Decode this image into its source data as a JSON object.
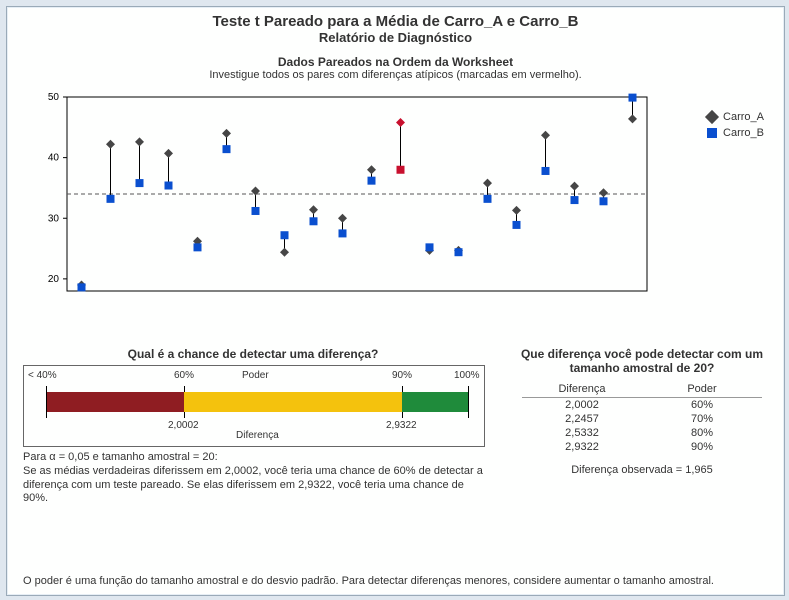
{
  "report": {
    "title": "Teste t Pareado para a Média de Carro_A e Carro_B",
    "subtitle": "Relatório de Diagnóstico"
  },
  "pair_plot": {
    "title": "Dados Pareados na Ordem da Worksheet",
    "subtitle": "Investigue todos os pares com diferenças atípicos (marcadas em vermelho).",
    "legend": {
      "seriesA": "Carro_A",
      "seriesB": "Carro_B"
    }
  },
  "power_plot": {
    "title": "Qual é a chance de detectar uma diferença?",
    "axis_power": "Poder",
    "axis_diff": "Diferença",
    "ticks": {
      "p_lt40": "< 40%",
      "p60": "60%",
      "p90": "90%",
      "p100": "100%",
      "d60": "2,0002",
      "d90": "2,9322"
    },
    "note_line1": "Para α = 0,05 e tamanho amostral = 20:",
    "note_line2": "Se as médias verdadeiras diferissem em 2,0002, você teria uma chance de 60% de detectar a diferença com um teste pareado. Se elas diferissem em 2,9322, você teria uma chance de 90%."
  },
  "detect": {
    "title_l1": "Que diferença você pode detectar com um",
    "title_l2": "tamanho amostral de 20?",
    "col_diff": "Diferença",
    "col_power": "Poder",
    "rows": [
      {
        "diff": "2,0002",
        "power": "60%"
      },
      {
        "diff": "2,2457",
        "power": "70%"
      },
      {
        "diff": "2,5332",
        "power": "80%"
      },
      {
        "diff": "2,9322",
        "power": "90%"
      }
    ],
    "observed": "Diferença observada = 1,965"
  },
  "footer": "O poder é uma função do tamanho amostral e do desvio padrão. Para detectar diferenças menores, considere aumentar o tamanho amostral.",
  "chart_data": {
    "type": "scatter",
    "title": "Dados Pareados na Ordem da Worksheet",
    "ylabel": "",
    "ylim": [
      18,
      50
    ],
    "y_ticks": [
      20,
      30,
      40,
      50
    ],
    "x_range": [
      1,
      20
    ],
    "mean_diff_ref": 34,
    "series": [
      {
        "name": "Carro_A",
        "marker": "diamond",
        "color": "#464646",
        "values": [
          19.0,
          42.2,
          42.6,
          40.7,
          26.2,
          44.0,
          34.5,
          24.4,
          31.4,
          30.0,
          38.0,
          45.8,
          24.7,
          24.7,
          35.8,
          31.3,
          43.7,
          35.3,
          34.2,
          46.4
        ]
      },
      {
        "name": "Carro_B",
        "marker": "square",
        "color": "#0a4fcf",
        "values": [
          18.6,
          33.2,
          35.8,
          35.4,
          25.2,
          41.4,
          31.2,
          27.2,
          29.5,
          27.5,
          36.2,
          38.0,
          25.2,
          24.4,
          33.2,
          28.9,
          37.8,
          33.0,
          32.8,
          49.9
        ]
      }
    ],
    "outlier_indices": [
      12
    ],
    "power_chart": {
      "type": "bar",
      "axis": "Diferença",
      "segments": [
        {
          "label": "< 40%",
          "from": 0,
          "to": 0.05,
          "color": "#ffffff"
        },
        {
          "label": "40–60%",
          "from": 0.05,
          "to": 0.35,
          "color": "#8f1d22"
        },
        {
          "label": "60–90%",
          "from": 0.35,
          "to": 0.82,
          "color": "#f4c20d"
        },
        {
          "label": "90–100%",
          "from": 0.82,
          "to": 0.97,
          "color": "#1f8b3b"
        }
      ],
      "ticks_power": [
        "< 40%",
        "60%",
        "90%",
        "100%"
      ],
      "ticks_diff": {
        "60%": 2.0002,
        "90%": 2.9322
      }
    },
    "detect_table": {
      "n": 20,
      "alpha": 0.05,
      "rows": [
        {
          "diff": 2.0002,
          "power": 0.6
        },
        {
          "diff": 2.2457,
          "power": 0.7
        },
        {
          "diff": 2.5332,
          "power": 0.8
        },
        {
          "diff": 2.9322,
          "power": 0.9
        }
      ],
      "observed_diff": 1.965
    }
  }
}
